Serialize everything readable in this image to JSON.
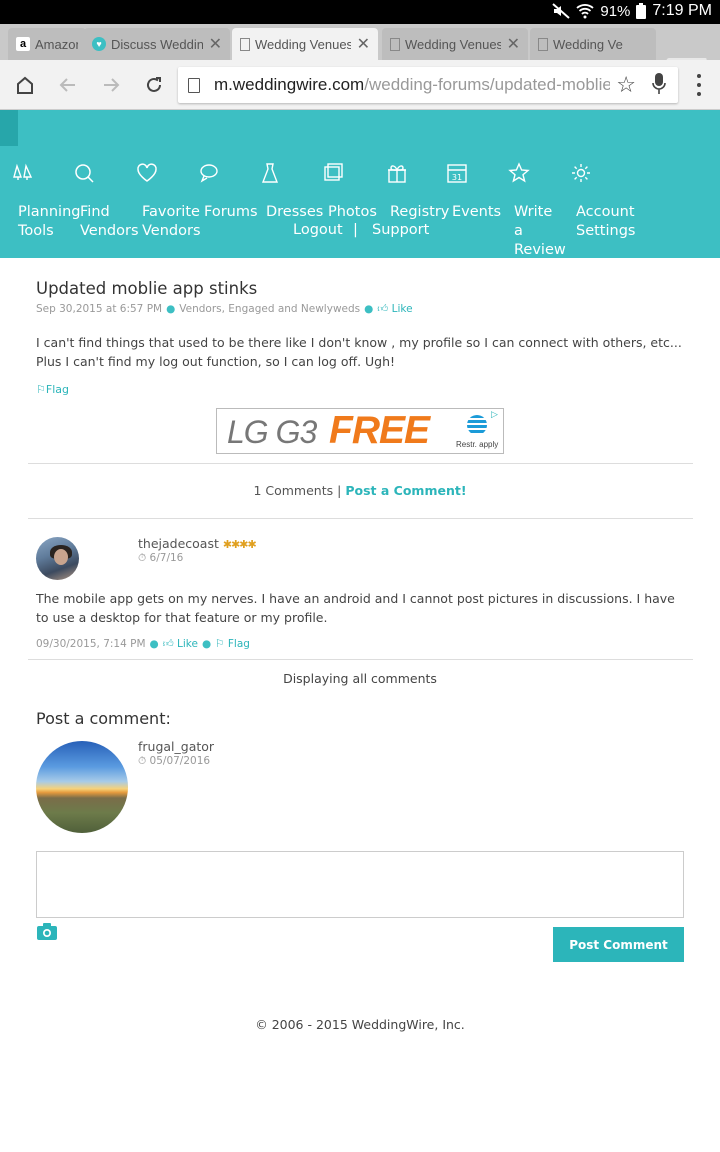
{
  "status_bar": {
    "battery": "91%",
    "time": "7:19 PM"
  },
  "tabs": [
    {
      "label": "Amazon",
      "icon": "amazon-icon"
    },
    {
      "label": "Discuss Wedding",
      "icon": "weddingwire-icon"
    },
    {
      "label": "Wedding Venues",
      "icon": "page-icon",
      "active": true
    },
    {
      "label": "Wedding Venues",
      "icon": "page-icon"
    },
    {
      "label": "Wedding Ve",
      "icon": "page-icon"
    }
  ],
  "url": {
    "host": "m.weddingwire.com",
    "path": "/wedding-forums/updated-moblie-"
  },
  "nav": {
    "planning_tools": "Planning Tools",
    "find_vendors": "Find Vendors",
    "favorite_vendors": "Favorite Vendors",
    "forums": "Forums",
    "dresses": "Dresses",
    "photos": "Photos",
    "registry": "Registry",
    "events": "Events",
    "write_review": "Write a Review",
    "account_settings": "Account Settings",
    "logout": "Logout",
    "separator": "|",
    "support": "Support"
  },
  "post": {
    "title": "Updated moblie app stinks",
    "date": "Sep 30,2015 at 6:57 PM",
    "category": "Vendors, Engaged and Newlyweds",
    "like_label": "Like",
    "body": "I can't find things that used to be there like I don't know , my profile so I can connect with others, etc... Plus I can't find my log out function, so I can log off. Ugh!",
    "flag_label": "Flag"
  },
  "ad": {
    "brand": "LG G3",
    "offer": "FREE",
    "fine_print": "Restr. apply"
  },
  "comments_bar": {
    "count_text": "1 Comments",
    "separator": "|",
    "post_link": "Post a Comment!"
  },
  "comment": {
    "username": "thejadecoast",
    "stars": "✱✱✱✱",
    "date": "6/7/16",
    "body": "The mobile app gets on my nerves. I have an android and I cannot post pictures in discussions. I have to use a desktop for that feature or my profile.",
    "timestamp": "09/30/2015, 7:14 PM",
    "like_label": "Like",
    "flag_label": "Flag"
  },
  "display_all": "Displaying all comments",
  "post_form": {
    "title": "Post a comment:",
    "username": "frugal_gator",
    "date": "05/07/2016",
    "textarea_value": "",
    "button_label": "Post Comment"
  },
  "footer": "© 2006 - 2015 WeddingWire, Inc.",
  "colors": {
    "brand_teal": "#3dbfc3",
    "link_teal": "#2cb5ba",
    "star_gold": "#e0a020",
    "ad_orange": "#f07a1b"
  }
}
